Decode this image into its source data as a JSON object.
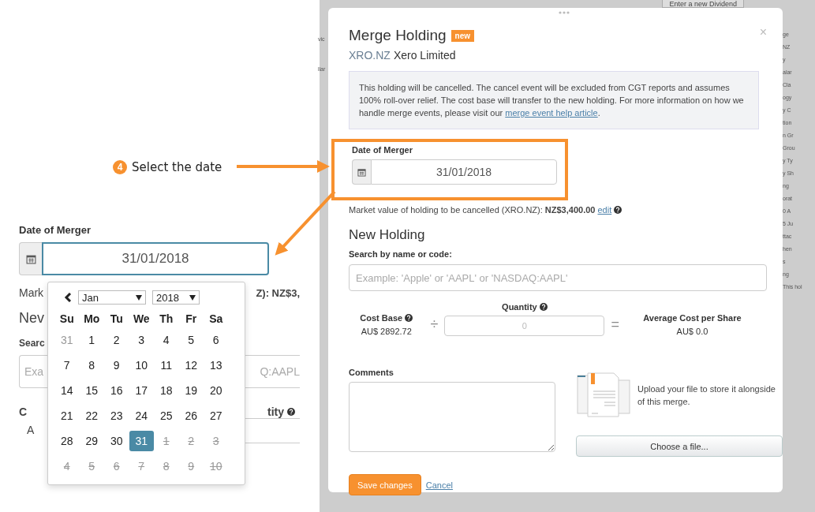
{
  "annotation": {
    "step": "4",
    "text": "Select the date"
  },
  "inset": {
    "label": "Date of Merger",
    "date_value": "31/01/2018",
    "market_left": "Mark",
    "market_right": "Z): NZ$3,",
    "heading": "Nev",
    "search_label": "Searc",
    "search_left": "Exa",
    "search_right": "Q:AAPL",
    "quantity_label": "tity",
    "cost_label": "C",
    "cost_value": "A",
    "calendar": {
      "month": "Jan",
      "year": "2018",
      "weekdays": [
        "Su",
        "Mo",
        "Tu",
        "We",
        "Th",
        "Fr",
        "Sa"
      ],
      "weeks": [
        [
          {
            "day": "31",
            "kind": "prev",
            "selected": false
          },
          {
            "day": "1",
            "kind": "current",
            "selected": false
          },
          {
            "day": "2",
            "kind": "current",
            "selected": false
          },
          {
            "day": "3",
            "kind": "current",
            "selected": false
          },
          {
            "day": "4",
            "kind": "current",
            "selected": false
          },
          {
            "day": "5",
            "kind": "current",
            "selected": false
          },
          {
            "day": "6",
            "kind": "current",
            "selected": false
          }
        ],
        [
          {
            "day": "7",
            "kind": "current",
            "selected": false
          },
          {
            "day": "8",
            "kind": "current",
            "selected": false
          },
          {
            "day": "9",
            "kind": "current",
            "selected": false
          },
          {
            "day": "10",
            "kind": "current",
            "selected": false
          },
          {
            "day": "11",
            "kind": "current",
            "selected": false
          },
          {
            "day": "12",
            "kind": "current",
            "selected": false
          },
          {
            "day": "13",
            "kind": "current",
            "selected": false
          }
        ],
        [
          {
            "day": "14",
            "kind": "current",
            "selected": false
          },
          {
            "day": "15",
            "kind": "current",
            "selected": false
          },
          {
            "day": "16",
            "kind": "current",
            "selected": false
          },
          {
            "day": "17",
            "kind": "current",
            "selected": false
          },
          {
            "day": "18",
            "kind": "current",
            "selected": false
          },
          {
            "day": "19",
            "kind": "current",
            "selected": false
          },
          {
            "day": "20",
            "kind": "current",
            "selected": false
          }
        ],
        [
          {
            "day": "21",
            "kind": "current",
            "selected": false
          },
          {
            "day": "22",
            "kind": "current",
            "selected": false
          },
          {
            "day": "23",
            "kind": "current",
            "selected": false
          },
          {
            "day": "24",
            "kind": "current",
            "selected": false
          },
          {
            "day": "25",
            "kind": "current",
            "selected": false
          },
          {
            "day": "26",
            "kind": "current",
            "selected": false
          },
          {
            "day": "27",
            "kind": "current",
            "selected": false
          }
        ],
        [
          {
            "day": "28",
            "kind": "current",
            "selected": false
          },
          {
            "day": "29",
            "kind": "current",
            "selected": false
          },
          {
            "day": "30",
            "kind": "current",
            "selected": false
          },
          {
            "day": "31",
            "kind": "current",
            "selected": true
          },
          {
            "day": "1",
            "kind": "next",
            "selected": false
          },
          {
            "day": "2",
            "kind": "next",
            "selected": false
          },
          {
            "day": "3",
            "kind": "next",
            "selected": false
          }
        ],
        [
          {
            "day": "4",
            "kind": "next",
            "selected": false
          },
          {
            "day": "5",
            "kind": "next",
            "selected": false
          },
          {
            "day": "6",
            "kind": "next",
            "selected": false
          },
          {
            "day": "7",
            "kind": "next",
            "selected": false
          },
          {
            "day": "8",
            "kind": "next",
            "selected": false
          },
          {
            "day": "9",
            "kind": "next",
            "selected": false
          },
          {
            "day": "10",
            "kind": "next",
            "selected": false
          }
        ]
      ]
    }
  },
  "background": {
    "top_button": "Enter a new Dividend",
    "left_fragments": [
      "vic",
      "llar"
    ],
    "right_fragments": [
      "ge",
      "NZ",
      "y",
      "alar",
      "Cla",
      "ogy",
      "y C",
      "tion",
      "n Gr",
      "Grou",
      "y Ty",
      "y Sh",
      "ng",
      "orat",
      "0 A",
      "5 Ju",
      "ttac",
      "hen",
      "s",
      "ng",
      "This hol"
    ]
  },
  "modal": {
    "title": "Merge Holding",
    "badge": "new",
    "ticker": "XRO.NZ",
    "company": "Xero Limited",
    "info": {
      "text_before": "This holding will be cancelled. The cancel event will be excluded from CGT reports and assumes 100% roll-over relief. The cost base will transfer to the new holding. For more information on how we handle merge events, please visit our ",
      "link": "merge event help article",
      "text_after": "."
    },
    "date_label": "Date of Merger",
    "date_value": "31/01/2018",
    "market_text": "Market value of holding to be cancelled (XRO.NZ): **NZ$3,400.00**",
    "market_link": "edit",
    "new_holding": "New Holding",
    "search_label": "Search by name or code:",
    "search_placeholder": "Example: 'Apple' or 'AAPL' or 'NASDAQ:AAPL'",
    "cost_label": "Cost Base",
    "cost_value": "AU$ 2892.72",
    "divide": "÷",
    "quantity_label": "Quantity",
    "quantity_placeholder": "0",
    "equals": "=",
    "average_label": "Average Cost per Share",
    "average_value": "AU$ 0.0",
    "comments_label": "Comments",
    "upload_text": "Upload your file to store it alongside of this merge.",
    "choose_button": "Choose a file...",
    "save_button": "Save changes",
    "cancel_link": "Cancel",
    "close": "×"
  }
}
